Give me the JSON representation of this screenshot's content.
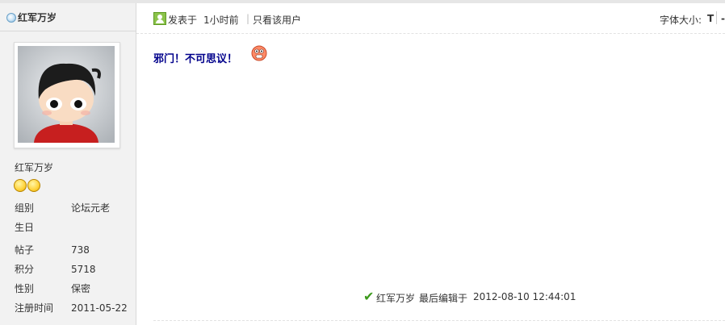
{
  "sidebar": {
    "header_name": "红军万岁",
    "username": "红军万岁",
    "info": [
      {
        "label": "组别",
        "value": "论坛元老"
      },
      {
        "label": "生日",
        "value": ""
      },
      {
        "label": "帖子",
        "value": "738"
      },
      {
        "label": "积分",
        "value": "5718"
      },
      {
        "label": "性别",
        "value": "保密"
      },
      {
        "label": "注册时间",
        "value": "2011-05-22"
      }
    ],
    "rank_icons": [
      "smiley-icon",
      "smiley-icon"
    ]
  },
  "post": {
    "posted_label": "发表于",
    "posted_time": "1小时前",
    "separator": "|",
    "only_author_label": "只看该用户",
    "font_size_label": "字体大小:",
    "font_size_option": "T",
    "font_size_option_2": "-",
    "content": "邪门！不可思议！",
    "content_emoji": "shocked-face-icon",
    "edit_user": "红军万岁",
    "edit_label": "最后编辑于",
    "edit_time": "2012-08-10 12:44:01"
  },
  "colors": {
    "sidebar_bg": "#f2f2f2",
    "content_text": "#00008b",
    "check_green": "#3c9a1c"
  }
}
